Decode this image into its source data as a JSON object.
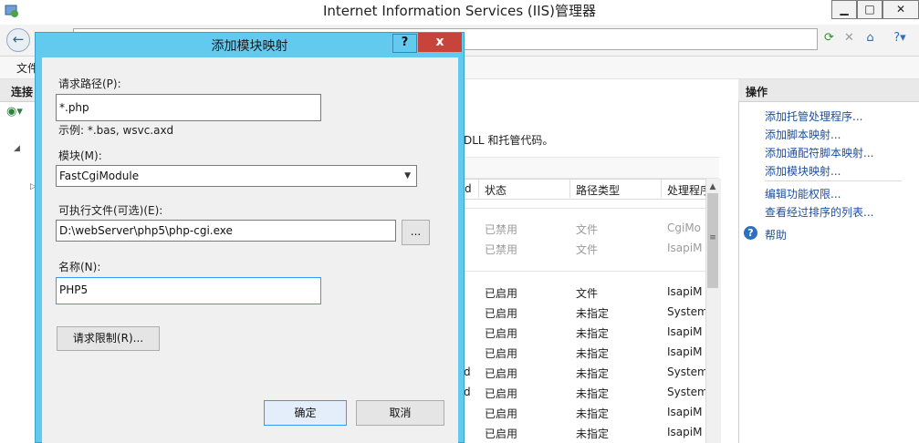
{
  "window": {
    "title": "Internet Information Services (IIS)管理器",
    "minimize": "▁",
    "maximize": "□",
    "close": "✕"
  },
  "menu": {
    "file": "文件"
  },
  "left_pane": {
    "header": "连接"
  },
  "center": {
    "description_tail": "DLL 和托管代码。",
    "columns": [
      "d",
      "状态",
      "路径类型",
      "处理程序"
    ],
    "rows_group1": [
      {
        "status": "已禁用",
        "path_type": "文件",
        "handler": "CgiMo"
      },
      {
        "status": "已禁用",
        "path_type": "文件",
        "handler": "IsapiM"
      }
    ],
    "rows_group2": [
      {
        "prefix": "",
        "status": "已启用",
        "path_type": "文件",
        "handler": "IsapiM"
      },
      {
        "prefix": "",
        "status": "已启用",
        "path_type": "未指定",
        "handler": "System"
      },
      {
        "prefix": "",
        "status": "已启用",
        "path_type": "未指定",
        "handler": "IsapiM"
      },
      {
        "prefix": "",
        "status": "已启用",
        "path_type": "未指定",
        "handler": "IsapiM"
      },
      {
        "prefix": "d",
        "status": "已启用",
        "path_type": "未指定",
        "handler": "System"
      },
      {
        "prefix": "d",
        "status": "已启用",
        "path_type": "未指定",
        "handler": "System"
      },
      {
        "prefix": "",
        "status": "已启用",
        "path_type": "未指定",
        "handler": "IsapiM"
      },
      {
        "prefix": "",
        "status": "已启用",
        "path_type": "未指定",
        "handler": "IsapiM"
      }
    ]
  },
  "right_pane": {
    "header": "操作",
    "actions": [
      "添加托管处理程序...",
      "添加脚本映射...",
      "添加通配符脚本映射...",
      "添加模块映射..."
    ],
    "actions2": [
      "编辑功能权限...",
      "查看经过排序的列表..."
    ],
    "help": "帮助"
  },
  "dialog": {
    "title": "添加模块映射",
    "help_button": "?",
    "close_button": "x",
    "request_path_label": "请求路径(P):",
    "request_path_value": "*.php",
    "example": "示例: *.bas, wsvc.axd",
    "module_label": "模块(M):",
    "module_value": "FastCgiModule",
    "executable_label": "可执行文件(可选)(E):",
    "executable_value": "D:\\webServer\\php5\\php-cgi.exe",
    "browse_button": "...",
    "name_label": "名称(N):",
    "name_value": "PHP5",
    "restrictions_button": "请求限制(R)...",
    "ok_button": "确定",
    "cancel_button": "取消"
  }
}
